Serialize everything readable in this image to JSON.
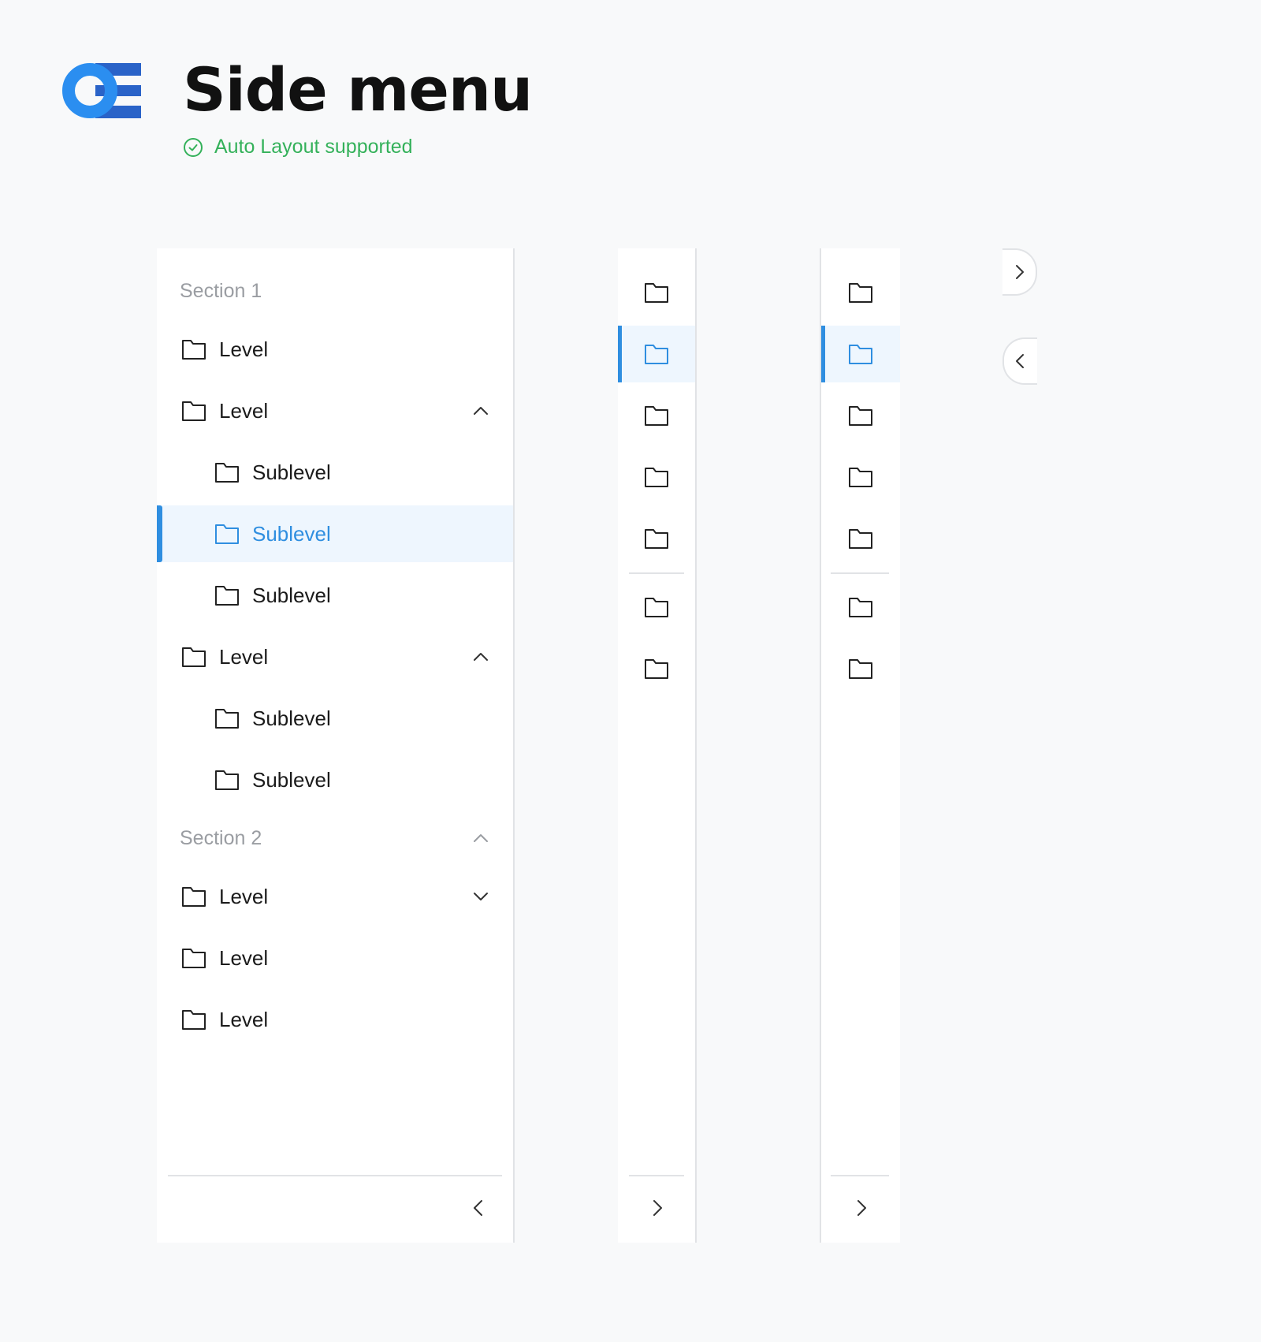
{
  "header": {
    "title": "Side menu",
    "subtitle": "Auto Layout supported",
    "logo_icon": "brand-logo-icon",
    "colors": {
      "accent": "#2f8ee0",
      "success": "#34b15a",
      "logo_blue": "#2b8ef0"
    }
  },
  "full_menu": {
    "section1_label": "Section 1",
    "section2_label": "Section 2",
    "items": [
      {
        "label": "Level",
        "kind": "level",
        "chevron": "none"
      },
      {
        "label": "Level",
        "kind": "level",
        "chevron": "up"
      },
      {
        "label": "Sublevel",
        "kind": "sublevel",
        "chevron": "none"
      },
      {
        "label": "Sublevel",
        "kind": "sublevel",
        "chevron": "none",
        "active": true
      },
      {
        "label": "Sublevel",
        "kind": "sublevel",
        "chevron": "none"
      },
      {
        "label": "Level",
        "kind": "level",
        "chevron": "up"
      },
      {
        "label": "Sublevel",
        "kind": "sublevel",
        "chevron": "none"
      },
      {
        "label": "Sublevel",
        "kind": "sublevel",
        "chevron": "none"
      },
      {
        "label": "Level",
        "kind": "level",
        "chevron": "down"
      },
      {
        "label": "Level",
        "kind": "level",
        "chevron": "none"
      },
      {
        "label": "Level",
        "kind": "level",
        "chevron": "none"
      }
    ],
    "section2_chevron": "up",
    "footer_button_icon": "chevron-left-icon"
  },
  "collapsed_menu": {
    "icons": [
      "folder-icon",
      "folder-icon",
      "folder-icon",
      "folder-icon",
      "folder-icon",
      "folder-icon",
      "folder-icon"
    ],
    "active_index": 1,
    "footer_button_icon": "chevron-right-icon"
  },
  "floating_buttons": {
    "expand_icon": "chevron-right-icon",
    "collapse_icon": "chevron-left-icon"
  }
}
